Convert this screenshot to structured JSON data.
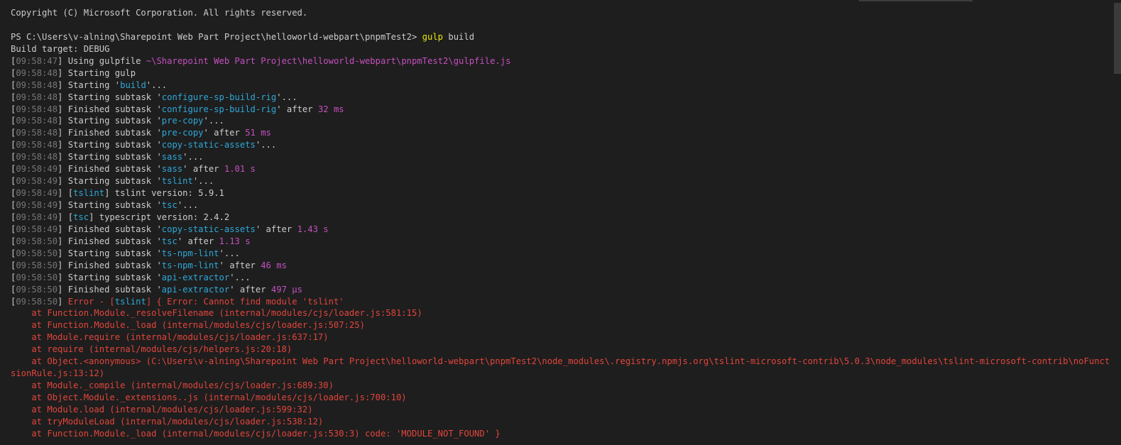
{
  "terminal": {
    "colors": {
      "background": "#1e1e1e",
      "text": "#cccccc",
      "timestamp_bracket": "#767676",
      "task_name": "#2ea8d8",
      "duration": "#c550c0",
      "command": "#e5e510",
      "error": "#e2453c"
    },
    "lines": [
      [
        {
          "t": "Copyright (C) Microsoft Corporation. All rights reserved.",
          "c": "text"
        }
      ],
      [
        {
          "t": "",
          "c": "text"
        }
      ],
      [
        {
          "t": "PS C:\\Users\\v-alning\\Sharepoint Web Part Project\\helloworld-webpart\\pnpmTest2> ",
          "c": "text"
        },
        {
          "t": "gulp",
          "c": "yellow"
        },
        {
          "t": " build",
          "c": "text"
        }
      ],
      [
        {
          "t": "Build target: DEBUG",
          "c": "text"
        }
      ],
      [
        {
          "t": "[",
          "c": "text"
        },
        {
          "t": "09:58:47",
          "c": "gray"
        },
        {
          "t": "] Using gulpfile ",
          "c": "text"
        },
        {
          "t": "~\\Sharepoint Web Part Project\\helloworld-webpart\\pnpmTest2\\gulpfile.js",
          "c": "magenta"
        }
      ],
      [
        {
          "t": "[",
          "c": "text"
        },
        {
          "t": "09:58:48",
          "c": "gray"
        },
        {
          "t": "] Starting gulp",
          "c": "text"
        }
      ],
      [
        {
          "t": "[",
          "c": "text"
        },
        {
          "t": "09:58:48",
          "c": "gray"
        },
        {
          "t": "] Starting '",
          "c": "text"
        },
        {
          "t": "build",
          "c": "cyan"
        },
        {
          "t": "'...",
          "c": "text"
        }
      ],
      [
        {
          "t": "[",
          "c": "text"
        },
        {
          "t": "09:58:48",
          "c": "gray"
        },
        {
          "t": "] Starting subtask '",
          "c": "text"
        },
        {
          "t": "configure-sp-build-rig",
          "c": "cyan"
        },
        {
          "t": "'...",
          "c": "text"
        }
      ],
      [
        {
          "t": "[",
          "c": "text"
        },
        {
          "t": "09:58:48",
          "c": "gray"
        },
        {
          "t": "] Finished subtask '",
          "c": "text"
        },
        {
          "t": "configure-sp-build-rig",
          "c": "cyan"
        },
        {
          "t": "' after ",
          "c": "text"
        },
        {
          "t": "32 ms",
          "c": "magenta"
        }
      ],
      [
        {
          "t": "[",
          "c": "text"
        },
        {
          "t": "09:58:48",
          "c": "gray"
        },
        {
          "t": "] Starting subtask '",
          "c": "text"
        },
        {
          "t": "pre-copy",
          "c": "cyan"
        },
        {
          "t": "'...",
          "c": "text"
        }
      ],
      [
        {
          "t": "[",
          "c": "text"
        },
        {
          "t": "09:58:48",
          "c": "gray"
        },
        {
          "t": "] Finished subtask '",
          "c": "text"
        },
        {
          "t": "pre-copy",
          "c": "cyan"
        },
        {
          "t": "' after ",
          "c": "text"
        },
        {
          "t": "51 ms",
          "c": "magenta"
        }
      ],
      [
        {
          "t": "[",
          "c": "text"
        },
        {
          "t": "09:58:48",
          "c": "gray"
        },
        {
          "t": "] Starting subtask '",
          "c": "text"
        },
        {
          "t": "copy-static-assets",
          "c": "cyan"
        },
        {
          "t": "'...",
          "c": "text"
        }
      ],
      [
        {
          "t": "[",
          "c": "text"
        },
        {
          "t": "09:58:48",
          "c": "gray"
        },
        {
          "t": "] Starting subtask '",
          "c": "text"
        },
        {
          "t": "sass",
          "c": "cyan"
        },
        {
          "t": "'...",
          "c": "text"
        }
      ],
      [
        {
          "t": "[",
          "c": "text"
        },
        {
          "t": "09:58:49",
          "c": "gray"
        },
        {
          "t": "] Finished subtask '",
          "c": "text"
        },
        {
          "t": "sass",
          "c": "cyan"
        },
        {
          "t": "' after ",
          "c": "text"
        },
        {
          "t": "1.01 s",
          "c": "magenta"
        }
      ],
      [
        {
          "t": "[",
          "c": "text"
        },
        {
          "t": "09:58:49",
          "c": "gray"
        },
        {
          "t": "] Starting subtask '",
          "c": "text"
        },
        {
          "t": "tslint",
          "c": "cyan"
        },
        {
          "t": "'...",
          "c": "text"
        }
      ],
      [
        {
          "t": "[",
          "c": "text"
        },
        {
          "t": "09:58:49",
          "c": "gray"
        },
        {
          "t": "] [",
          "c": "text"
        },
        {
          "t": "tslint",
          "c": "cyan"
        },
        {
          "t": "] tslint version: 5.9.1",
          "c": "text"
        }
      ],
      [
        {
          "t": "[",
          "c": "text"
        },
        {
          "t": "09:58:49",
          "c": "gray"
        },
        {
          "t": "] Starting subtask '",
          "c": "text"
        },
        {
          "t": "tsc",
          "c": "cyan"
        },
        {
          "t": "'...",
          "c": "text"
        }
      ],
      [
        {
          "t": "[",
          "c": "text"
        },
        {
          "t": "09:58:49",
          "c": "gray"
        },
        {
          "t": "] [",
          "c": "text"
        },
        {
          "t": "tsc",
          "c": "cyan"
        },
        {
          "t": "] typescript version: 2.4.2",
          "c": "text"
        }
      ],
      [
        {
          "t": "[",
          "c": "text"
        },
        {
          "t": "09:58:49",
          "c": "gray"
        },
        {
          "t": "] Finished subtask '",
          "c": "text"
        },
        {
          "t": "copy-static-assets",
          "c": "cyan"
        },
        {
          "t": "' after ",
          "c": "text"
        },
        {
          "t": "1.43 s",
          "c": "magenta"
        }
      ],
      [
        {
          "t": "[",
          "c": "text"
        },
        {
          "t": "09:58:50",
          "c": "gray"
        },
        {
          "t": "] Finished subtask '",
          "c": "text"
        },
        {
          "t": "tsc",
          "c": "cyan"
        },
        {
          "t": "' after ",
          "c": "text"
        },
        {
          "t": "1.13 s",
          "c": "magenta"
        }
      ],
      [
        {
          "t": "[",
          "c": "text"
        },
        {
          "t": "09:58:50",
          "c": "gray"
        },
        {
          "t": "] Starting subtask '",
          "c": "text"
        },
        {
          "t": "ts-npm-lint",
          "c": "cyan"
        },
        {
          "t": "'...",
          "c": "text"
        }
      ],
      [
        {
          "t": "[",
          "c": "text"
        },
        {
          "t": "09:58:50",
          "c": "gray"
        },
        {
          "t": "] Finished subtask '",
          "c": "text"
        },
        {
          "t": "ts-npm-lint",
          "c": "cyan"
        },
        {
          "t": "' after ",
          "c": "text"
        },
        {
          "t": "46 ms",
          "c": "magenta"
        }
      ],
      [
        {
          "t": "[",
          "c": "text"
        },
        {
          "t": "09:58:50",
          "c": "gray"
        },
        {
          "t": "] Starting subtask '",
          "c": "text"
        },
        {
          "t": "api-extractor",
          "c": "cyan"
        },
        {
          "t": "'...",
          "c": "text"
        }
      ],
      [
        {
          "t": "[",
          "c": "text"
        },
        {
          "t": "09:58:50",
          "c": "gray"
        },
        {
          "t": "] Finished subtask '",
          "c": "text"
        },
        {
          "t": "api-extractor",
          "c": "cyan"
        },
        {
          "t": "' after ",
          "c": "text"
        },
        {
          "t": "497 μs",
          "c": "magenta"
        }
      ],
      [
        {
          "t": "[",
          "c": "text"
        },
        {
          "t": "09:58:50",
          "c": "gray"
        },
        {
          "t": "] ",
          "c": "text"
        },
        {
          "t": "Error - [",
          "c": "red"
        },
        {
          "t": "tslint",
          "c": "cyan"
        },
        {
          "t": "] { Error: Cannot find module 'tslint'",
          "c": "red"
        }
      ],
      [
        {
          "t": "    at Function.Module._resolveFilename (internal/modules/cjs/loader.js:581:15)",
          "c": "red"
        }
      ],
      [
        {
          "t": "    at Function.Module._load (internal/modules/cjs/loader.js:507:25)",
          "c": "red"
        }
      ],
      [
        {
          "t": "    at Module.require (internal/modules/cjs/loader.js:637:17)",
          "c": "red"
        }
      ],
      [
        {
          "t": "    at require (internal/modules/cjs/helpers.js:20:18)",
          "c": "red"
        }
      ],
      [
        {
          "t": "    at Object.<anonymous> (C:\\Users\\v-alning\\Sharepoint Web Part Project\\helloworld-webpart\\pnpmTest2\\node_modules\\.registry.npmjs.org\\tslint-microsoft-contrib\\5.0.3\\node_modules\\tslint-microsoft-contrib\\noFunctionExpres",
          "c": "red"
        }
      ],
      [
        {
          "t": "sionRule.js:13:12)",
          "c": "red"
        }
      ],
      [
        {
          "t": "    at Module._compile (internal/modules/cjs/loader.js:689:30)",
          "c": "red"
        }
      ],
      [
        {
          "t": "    at Object.Module._extensions..js (internal/modules/cjs/loader.js:700:10)",
          "c": "red"
        }
      ],
      [
        {
          "t": "    at Module.load (internal/modules/cjs/loader.js:599:32)",
          "c": "red"
        }
      ],
      [
        {
          "t": "    at tryModuleLoad (internal/modules/cjs/loader.js:538:12)",
          "c": "red"
        }
      ],
      [
        {
          "t": "    at Function.Module._load (internal/modules/cjs/loader.js:530:3) code: 'MODULE_NOT_FOUND' }",
          "c": "red"
        }
      ]
    ]
  }
}
